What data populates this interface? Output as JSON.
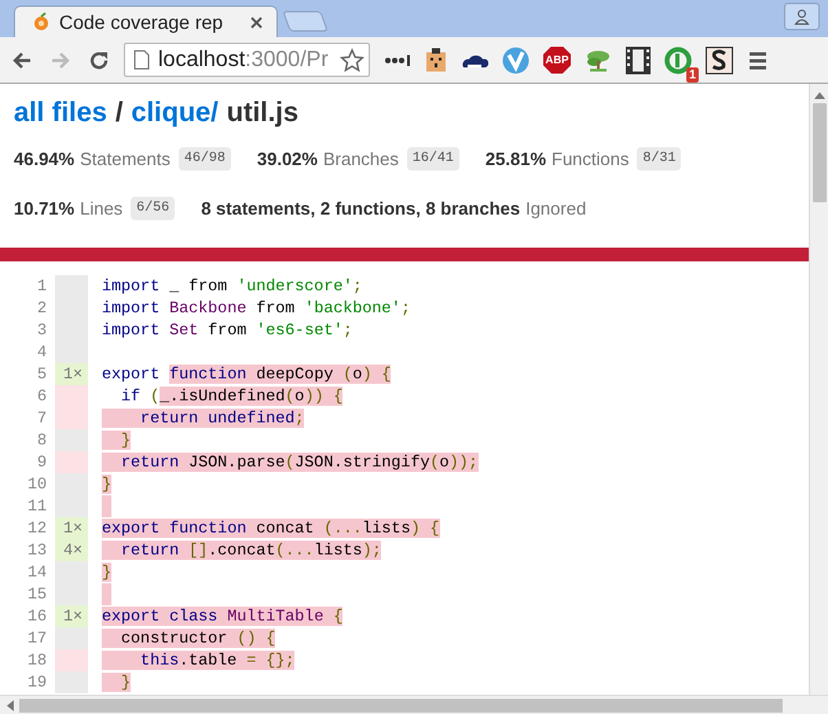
{
  "browser": {
    "tabs": [
      {
        "title": "Code coverage rep",
        "selected": true
      },
      {
        "selected": false
      }
    ],
    "address": {
      "host": "localhost",
      "rest": ":3000/Pr"
    },
    "abp_label": "ABP",
    "badge": "1"
  },
  "breadcrumb": [
    {
      "text": "all files",
      "kind": "link"
    },
    {
      "text": "/",
      "kind": "sep"
    },
    {
      "text": "clique/",
      "kind": "link"
    },
    {
      "text": "util.js",
      "kind": "current"
    }
  ],
  "stats": [
    {
      "pct": "46.94%",
      "label": "Statements",
      "fraction": "46/98"
    },
    {
      "pct": "39.02%",
      "label": "Branches",
      "fraction": "16/41"
    },
    {
      "pct": "25.81%",
      "label": "Functions",
      "fraction": "8/31"
    },
    {
      "pct": "10.71%",
      "label": "Lines",
      "fraction": "6/56"
    }
  ],
  "ignored": {
    "counts": "8 statements, 2 functions, 8 branches",
    "label": "Ignored"
  },
  "low_coverage": true,
  "lines": [
    {
      "no": "1",
      "kind": "plain",
      "blank_uncovered": false,
      "covered": [
        {
          "text": "import",
          "kind": "kwd"
        },
        {
          "text": " _ from ",
          "kind": "pln"
        },
        {
          "text": "'underscore'",
          "kind": "str"
        },
        {
          "text": ";",
          "kind": "pun"
        }
      ]
    },
    {
      "no": "2",
      "kind": "plain",
      "blank_uncovered": false,
      "covered": [
        {
          "text": "import",
          "kind": "kwd"
        },
        {
          "text": " Backbone",
          "kind": "typ"
        },
        {
          "text": " from ",
          "kind": "pln"
        },
        {
          "text": "'backbone'",
          "kind": "str"
        },
        {
          "text": ";",
          "kind": "pun"
        }
      ]
    },
    {
      "no": "3",
      "kind": "plain",
      "blank_uncovered": false,
      "covered": [
        {
          "text": "import",
          "kind": "kwd"
        },
        {
          "text": " Set",
          "kind": "typ"
        },
        {
          "text": " from ",
          "kind": "pln"
        },
        {
          "text": "'es6-set'",
          "kind": "str"
        },
        {
          "text": ";",
          "kind": "pun"
        }
      ]
    },
    {
      "no": "4",
      "kind": "plain",
      "blank_uncovered": false
    },
    {
      "no": "5",
      "kind": "hit",
      "count": "1×",
      "blank_uncovered": false,
      "covered": [
        {
          "text": "export ",
          "kind": "kwd"
        }
      ],
      "uncovered": [
        {
          "text": "function",
          "kind": "kwd"
        },
        {
          "text": " deepCopy ",
          "kind": "pln"
        },
        {
          "text": "(",
          "kind": "pun"
        },
        {
          "text": "o",
          "kind": "pln"
        },
        {
          "text": ") {",
          "kind": "pun"
        }
      ]
    },
    {
      "no": "6",
      "kind": "missed",
      "blank_uncovered": false,
      "covered": [
        {
          "text": "  if",
          "kind": "kwd"
        },
        {
          "text": " (",
          "kind": "pun"
        }
      ],
      "uncovered": [
        {
          "text": "_.isUndefined",
          "kind": "pln"
        },
        {
          "text": "(",
          "kind": "pun"
        },
        {
          "text": "o",
          "kind": "pln"
        },
        {
          "text": ")) {",
          "kind": "pun"
        }
      ]
    },
    {
      "no": "7",
      "kind": "missed",
      "blank_uncovered": false,
      "uncovered": [
        {
          "text": "    return",
          "kind": "kwd"
        },
        {
          "text": " undefined",
          "kind": "kwd"
        },
        {
          "text": ";",
          "kind": "pun"
        }
      ]
    },
    {
      "no": "8",
      "kind": "plain",
      "blank_uncovered": false,
      "uncovered": [
        {
          "text": "  }",
          "kind": "pun"
        }
      ]
    },
    {
      "no": "9",
      "kind": "missed",
      "blank_uncovered": false,
      "uncovered": [
        {
          "text": "  return",
          "kind": "kwd"
        },
        {
          "text": " JSON.parse",
          "kind": "pln"
        },
        {
          "text": "(",
          "kind": "pun"
        },
        {
          "text": "JSON.stringify",
          "kind": "pln"
        },
        {
          "text": "(",
          "kind": "pun"
        },
        {
          "text": "o",
          "kind": "pln"
        },
        {
          "text": "));",
          "kind": "pun"
        }
      ]
    },
    {
      "no": "10",
      "kind": "plain",
      "blank_uncovered": false,
      "uncovered": [
        {
          "text": "}",
          "kind": "pun"
        }
      ]
    },
    {
      "no": "11",
      "kind": "plain",
      "blank_uncovered": true
    },
    {
      "no": "12",
      "kind": "hit",
      "count": "1×",
      "blank_uncovered": false,
      "uncovered": [
        {
          "text": "export",
          "kind": "kwd"
        },
        {
          "text": " function",
          "kind": "kwd"
        },
        {
          "text": " concat ",
          "kind": "pln"
        },
        {
          "text": "(...",
          "kind": "pun"
        },
        {
          "text": "lists",
          "kind": "pln"
        },
        {
          "text": ") {",
          "kind": "pun"
        }
      ]
    },
    {
      "no": "13",
      "kind": "hit",
      "count": "4×",
      "blank_uncovered": false,
      "uncovered": [
        {
          "text": "  return",
          "kind": "kwd"
        },
        {
          "text": " []",
          "kind": "pun"
        },
        {
          "text": ".concat",
          "kind": "pln"
        },
        {
          "text": "(...",
          "kind": "pun"
        },
        {
          "text": "lists",
          "kind": "pln"
        },
        {
          "text": ");",
          "kind": "pun"
        }
      ]
    },
    {
      "no": "14",
      "kind": "plain",
      "blank_uncovered": false,
      "uncovered": [
        {
          "text": "}",
          "kind": "pun"
        }
      ]
    },
    {
      "no": "15",
      "kind": "plain",
      "blank_uncovered": true
    },
    {
      "no": "16",
      "kind": "hit",
      "count": "1×",
      "blank_uncovered": false,
      "uncovered": [
        {
          "text": "export",
          "kind": "kwd"
        },
        {
          "text": " class",
          "kind": "kwd"
        },
        {
          "text": " MultiTable",
          "kind": "typ"
        },
        {
          "text": " {",
          "kind": "pun"
        }
      ]
    },
    {
      "no": "17",
      "kind": "plain",
      "blank_uncovered": false,
      "uncovered": [
        {
          "text": "  constructor ",
          "kind": "pln"
        },
        {
          "text": "() {",
          "kind": "pun"
        }
      ]
    },
    {
      "no": "18",
      "kind": "missed",
      "blank_uncovered": false,
      "uncovered": [
        {
          "text": "    this",
          "kind": "kwd"
        },
        {
          "text": ".table ",
          "kind": "pln"
        },
        {
          "text": "= {};",
          "kind": "pun"
        }
      ]
    },
    {
      "no": "19",
      "kind": "plain",
      "blank_uncovered": false,
      "uncovered": [
        {
          "text": "  }",
          "kind": "pun"
        }
      ]
    }
  ]
}
